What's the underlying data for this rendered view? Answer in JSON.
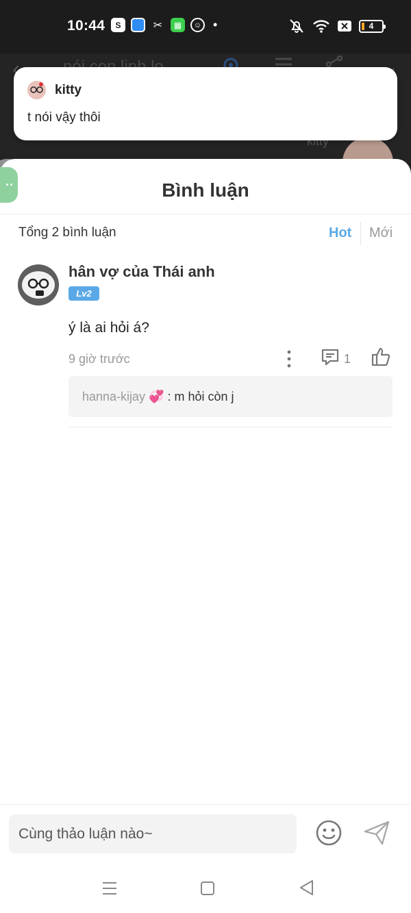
{
  "status_bar": {
    "time": "10:44",
    "battery": "4",
    "app_icons": [
      "shopee-icon",
      "bluebird-icon",
      "capcut-icon",
      "grid-app-icon",
      "smile-app-icon"
    ],
    "dot": "•"
  },
  "background": {
    "title": "nói con linh lo",
    "kitty_label": "kitty"
  },
  "notification": {
    "sender": "kitty",
    "message": "t nói vậy thôi"
  },
  "sheet": {
    "float_button_label": "··",
    "title": "Bình luận",
    "total_label": "Tổng 2 bình luận",
    "sort_hot": "Hot",
    "sort_new": "Mới"
  },
  "comments": [
    {
      "author": "hân vợ của Thái anh",
      "level": "Lv2",
      "text": "ý là ai hỏi á?",
      "time": "9 giờ trước",
      "reply_count": "1",
      "reply_preview": {
        "author": "hanna-kijay 💞",
        "separator": " : ",
        "text": "m hỏi còn j"
      }
    }
  ],
  "input": {
    "placeholder": "Cùng thảo luận nào~"
  },
  "colors": {
    "accent": "#5aa9e6",
    "status_bar_bg": "#1c1c1c",
    "float_button": "#8fd19e"
  }
}
